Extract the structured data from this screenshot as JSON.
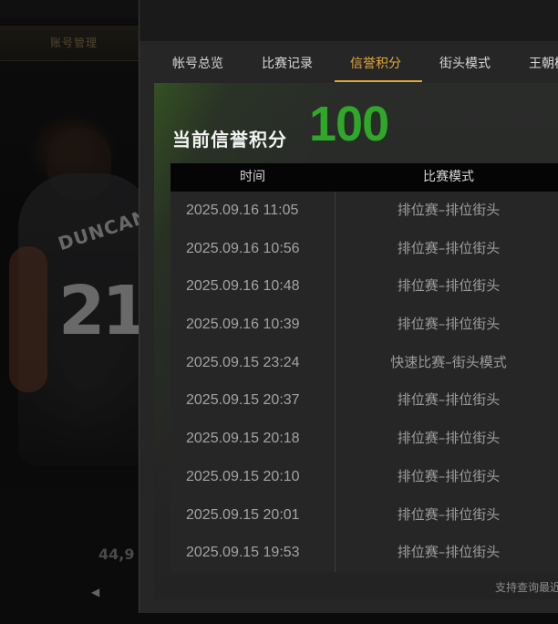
{
  "background": {
    "strip_label": "账号管理",
    "jersey_name": "DUNCAN",
    "jersey_number": "21",
    "score_fragment": "44,9",
    "arrow": "◀"
  },
  "tabs": [
    {
      "label": "帐号总览",
      "active": false
    },
    {
      "label": "比赛记录",
      "active": false
    },
    {
      "label": "信誉积分",
      "active": true
    },
    {
      "label": "街头模式",
      "active": false
    },
    {
      "label": "王朝模",
      "active": false
    }
  ],
  "credit": {
    "label": "当前信誉积分",
    "value": "100",
    "value_color": "#2fa82a"
  },
  "table": {
    "headers": [
      "时间",
      "比赛模式"
    ],
    "rows": [
      {
        "time": "2025.09.16  11:05",
        "mode": "排位赛–排位街头"
      },
      {
        "time": "2025.09.16  10:56",
        "mode": "排位赛–排位街头"
      },
      {
        "time": "2025.09.16  10:48",
        "mode": "排位赛–排位街头"
      },
      {
        "time": "2025.09.16  10:39",
        "mode": "排位赛–排位街头"
      },
      {
        "time": "2025.09.15  23:24",
        "mode": "快速比赛–街头模式"
      },
      {
        "time": "2025.09.15  20:37",
        "mode": "排位赛–排位街头"
      },
      {
        "time": "2025.09.15  20:18",
        "mode": "排位赛–排位街头"
      },
      {
        "time": "2025.09.15  20:10",
        "mode": "排位赛–排位街头"
      },
      {
        "time": "2025.09.15  20:01",
        "mode": "排位赛–排位街头"
      },
      {
        "time": "2025.09.15  19:53",
        "mode": "排位赛–排位街头"
      }
    ]
  },
  "footer_note": "支持查询最近",
  "colors": {
    "accent": "#e0a93a",
    "score_green": "#2fa82a"
  }
}
